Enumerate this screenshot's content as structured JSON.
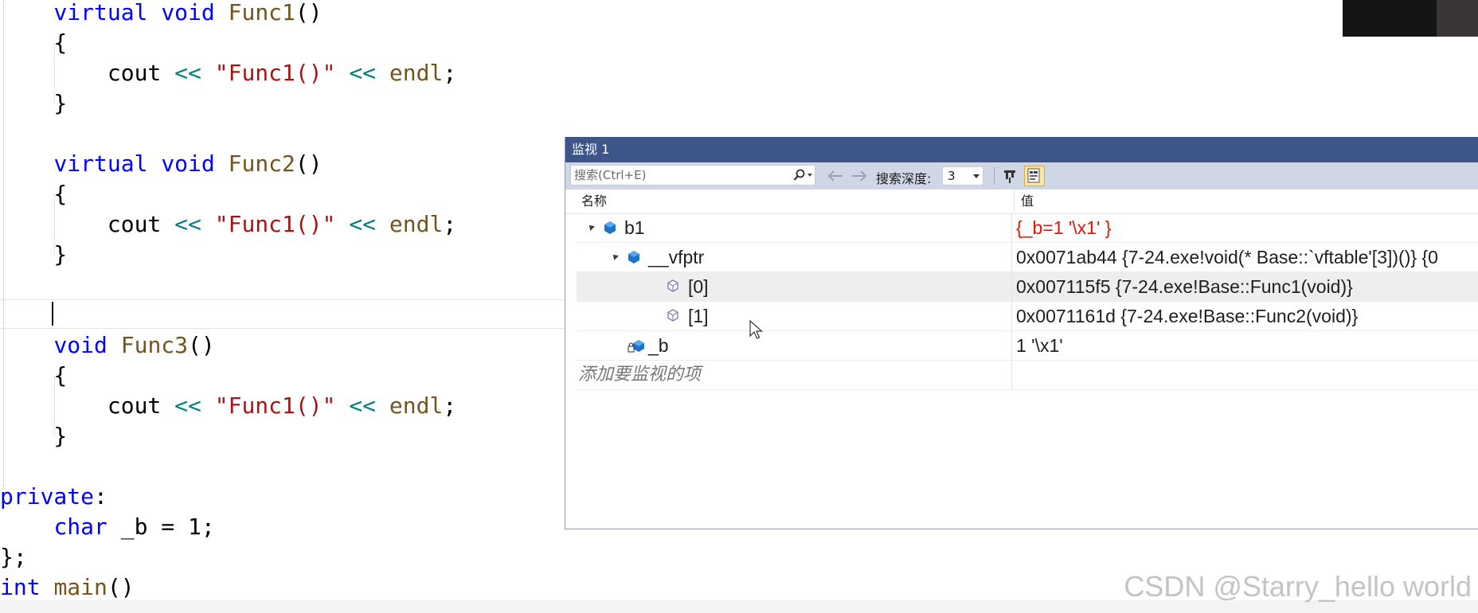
{
  "editor": {
    "lines": [
      {
        "parts": [
          {
            "t": "    "
          },
          {
            "t": "virtual",
            "c": "kw"
          },
          {
            "t": " "
          },
          {
            "t": "void",
            "c": "kw"
          },
          {
            "t": " "
          },
          {
            "t": "Func1",
            "c": "fn"
          },
          {
            "t": "()"
          }
        ]
      },
      {
        "parts": [
          {
            "t": "    {"
          }
        ]
      },
      {
        "parts": [
          {
            "t": "        cout "
          },
          {
            "t": "<<",
            "c": "op"
          },
          {
            "t": " "
          },
          {
            "t": "\"Func1()\"",
            "c": "str"
          },
          {
            "t": " "
          },
          {
            "t": "<<",
            "c": "op"
          },
          {
            "t": " "
          },
          {
            "t": "endl",
            "c": "fn"
          },
          {
            "t": ";"
          }
        ]
      },
      {
        "parts": [
          {
            "t": "    }"
          }
        ]
      },
      {
        "parts": [
          {
            "t": ""
          }
        ]
      },
      {
        "parts": [
          {
            "t": "    "
          },
          {
            "t": "virtual",
            "c": "kw"
          },
          {
            "t": " "
          },
          {
            "t": "void",
            "c": "kw"
          },
          {
            "t": " "
          },
          {
            "t": "Func2",
            "c": "fn"
          },
          {
            "t": "()"
          }
        ]
      },
      {
        "parts": [
          {
            "t": "    {"
          }
        ]
      },
      {
        "parts": [
          {
            "t": "        cout "
          },
          {
            "t": "<<",
            "c": "op"
          },
          {
            "t": " "
          },
          {
            "t": "\"Func1()\"",
            "c": "str"
          },
          {
            "t": " "
          },
          {
            "t": "<<",
            "c": "op"
          },
          {
            "t": " "
          },
          {
            "t": "endl",
            "c": "fn"
          },
          {
            "t": ";"
          }
        ]
      },
      {
        "parts": [
          {
            "t": "    }"
          }
        ]
      },
      {
        "parts": [
          {
            "t": ""
          }
        ]
      },
      {
        "parts": [
          {
            "t": ""
          }
        ]
      },
      {
        "parts": [
          {
            "t": "    "
          },
          {
            "t": "void",
            "c": "kw"
          },
          {
            "t": " "
          },
          {
            "t": "Func3",
            "c": "fn"
          },
          {
            "t": "()"
          }
        ]
      },
      {
        "parts": [
          {
            "t": "    {"
          }
        ]
      },
      {
        "parts": [
          {
            "t": "        cout "
          },
          {
            "t": "<<",
            "c": "op"
          },
          {
            "t": " "
          },
          {
            "t": "\"Func1()\"",
            "c": "str"
          },
          {
            "t": " "
          },
          {
            "t": "<<",
            "c": "op"
          },
          {
            "t": " "
          },
          {
            "t": "endl",
            "c": "fn"
          },
          {
            "t": ";"
          }
        ]
      },
      {
        "parts": [
          {
            "t": "    }"
          }
        ]
      },
      {
        "parts": [
          {
            "t": ""
          }
        ]
      },
      {
        "parts": [
          {
            "t": "private",
            "c": "kw"
          },
          {
            "t": ":"
          }
        ]
      },
      {
        "parts": [
          {
            "t": "    "
          },
          {
            "t": "char",
            "c": "kw"
          },
          {
            "t": " _b = 1;"
          }
        ]
      },
      {
        "parts": [
          {
            "t": "};"
          }
        ]
      },
      {
        "parts": [
          {
            "t": "int",
            "c": "kw"
          },
          {
            "t": " "
          },
          {
            "t": "main",
            "c": "fn"
          },
          {
            "t": "()"
          }
        ]
      }
    ]
  },
  "watch": {
    "title": "监视 1",
    "search_placeholder": "搜索(Ctrl+E)",
    "depth_label": "搜索深度:",
    "depth_value": "3",
    "columns": {
      "name": "名称",
      "value": "值"
    },
    "rows": [
      {
        "name": "b1",
        "value": "{_b=1 '\\x1' }",
        "level": 0,
        "expanded": true,
        "icon": "object-icon",
        "changed": true,
        "selected": false
      },
      {
        "name": "__vfptr",
        "value": "0x0071ab44 {7-24.exe!void(* Base::`vftable'[3])()} {0",
        "level": 1,
        "expanded": true,
        "icon": "object-icon",
        "changed": false,
        "selected": false
      },
      {
        "name": "[0]",
        "value": "0x007115f5 {7-24.exe!Base::Func1(void)}",
        "level": 2,
        "expanded": false,
        "icon": "element-icon",
        "changed": false,
        "selected": true
      },
      {
        "name": "[1]",
        "value": "0x0071161d {7-24.exe!Base::Func2(void)}",
        "level": 2,
        "expanded": false,
        "icon": "element-icon",
        "changed": false,
        "selected": false
      },
      {
        "name": "_b",
        "value": "1 '\\x1'",
        "level": 1,
        "expanded": false,
        "icon": "private-field-icon",
        "changed": false,
        "selected": false
      }
    ],
    "add_item": "添加要监视的项"
  },
  "watermark": "CSDN @Starry_hello world",
  "colors": {
    "title_bar": "#3e5589",
    "toolbar": "#cfd6e5",
    "changed_value": "#e51400",
    "keyword": "#0000ff",
    "string": "#a31515",
    "function": "#74531f",
    "operator": "#008080"
  }
}
